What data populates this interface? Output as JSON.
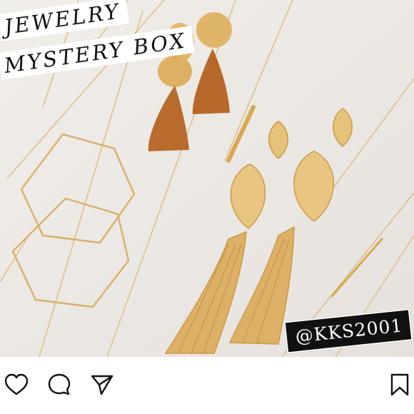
{
  "post": {
    "title_line_1": "JEWELRY",
    "title_line_2": "MYSTERY BOX",
    "handle": "@KKS2001"
  },
  "actions": {
    "like_icon": "heart-icon",
    "comment_icon": "comment-icon",
    "share_icon": "share-icon",
    "save_icon": "bookmark-icon"
  },
  "colors": {
    "background": "#ece7e2",
    "gold": "#d8b064",
    "tassel_rust": "#b86b2c",
    "label_black": "#111111"
  }
}
